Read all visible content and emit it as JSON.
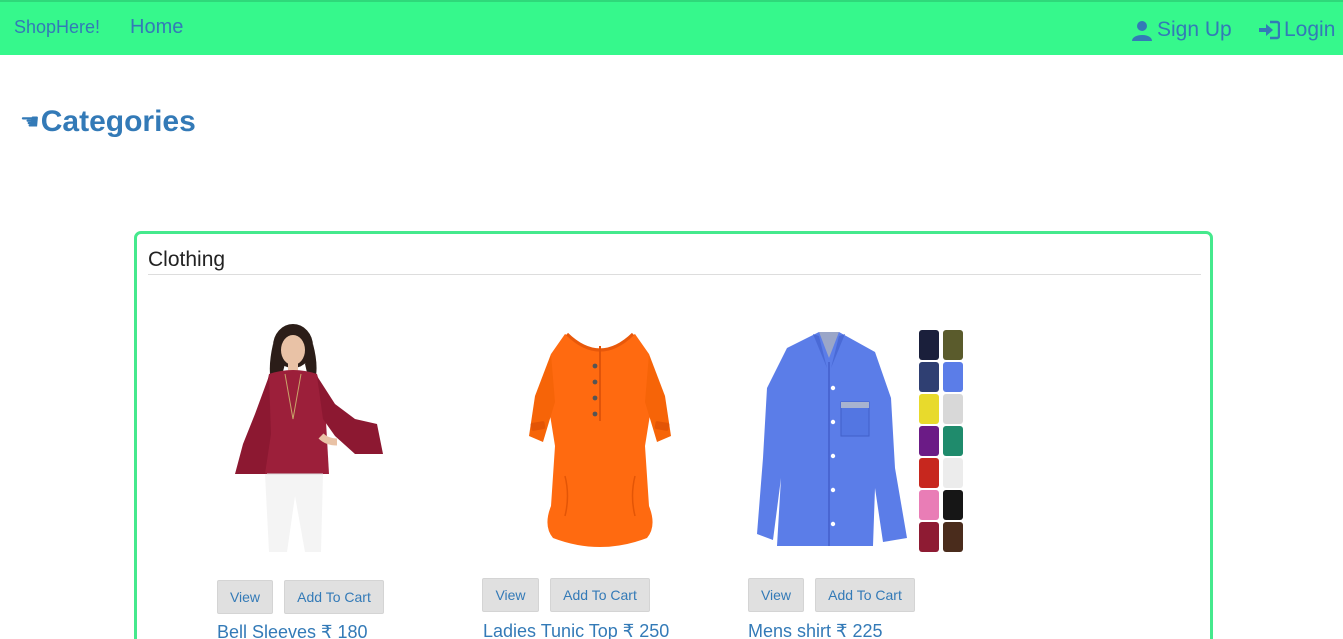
{
  "navbar": {
    "brand": "ShopHere!",
    "home": "Home",
    "signup": "Sign Up",
    "login": "Login"
  },
  "categories_heading": "Categories",
  "hand_icon": "☚",
  "panel": {
    "title": "Clothing"
  },
  "products": [
    {
      "title": "Bell Sleeves ₹ 180",
      "view": "View",
      "add": "Add To Cart",
      "image": "maroon-bell-sleeve-top"
    },
    {
      "title": "Ladies Tunic Top ₹ 250",
      "view": "View",
      "add": "Add To Cart",
      "image": "orange-tunic-top"
    },
    {
      "title": "Mens shirt ₹ 225",
      "view": "View",
      "add": "Add To Cart",
      "image": "blue-mens-shirt-with-color-swatches"
    }
  ],
  "colors": {
    "navbar": "#36f88c",
    "panel_border": "#45e98d",
    "link": "#337ab7"
  }
}
